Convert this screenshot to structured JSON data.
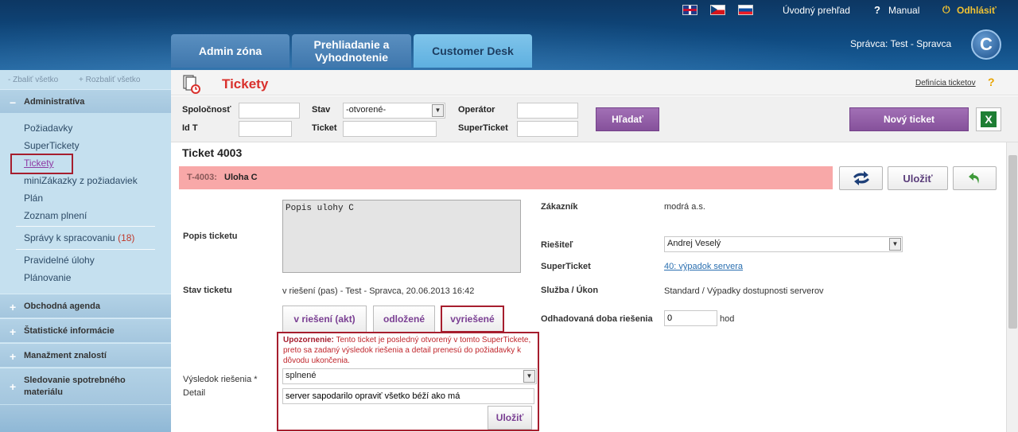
{
  "header": {
    "flags": [
      "uk-flag-icon",
      "cz-flag-icon",
      "sk-flag-icon"
    ],
    "overview_link": "Úvodný prehľad",
    "manual_link": "Manual",
    "logout_link": "Odhlásiť",
    "tabs": [
      "Admin zóna",
      "Prehliadanie a Vyhodnotenie",
      "Customer Desk"
    ],
    "active_tab": "Customer Desk",
    "manager_text": "Správca: Test - Spravca",
    "logo_letter": "C"
  },
  "sidebar": {
    "collapse_all": "- Zbaliť všetko",
    "expand_all": "+ Rozbaliť všetko",
    "sections": [
      {
        "label": "Administratíva",
        "sign": "−"
      },
      {
        "label": "Obchodná agenda",
        "sign": "+"
      },
      {
        "label": "Štatistické informácie",
        "sign": "+"
      },
      {
        "label": "Manažment znalostí",
        "sign": "+"
      },
      {
        "label": "Sledovanie spotrebného materiálu",
        "sign": "+"
      }
    ],
    "items": [
      "Požiadavky",
      "SuperTickety",
      "Tickety",
      "miniZákazky z požiadaviek",
      "Plán",
      "Zoznam plnení",
      "Správy k spracovaniu",
      "Pravidelné úlohy",
      "Plánovanie"
    ],
    "reports_count": "(18)",
    "active_item": "Tickety"
  },
  "page": {
    "title": "Tickety",
    "definition_link": "Definícia ticketov",
    "help_icon": "?"
  },
  "filters": {
    "company_label": "Spoločnosť",
    "company_value": "",
    "status_label": "Stav",
    "status_value": "-otvorené-",
    "operator_label": "Operátor",
    "operator_value": "",
    "id_label": "Id T",
    "id_value": "",
    "ticket_label": "Ticket",
    "ticket_value": "",
    "superticket_label": "SuperTicket",
    "superticket_value": "",
    "search_button": "Hľadať",
    "new_ticket_button": "Nový ticket"
  },
  "ticket": {
    "heading": "Ticket 4003",
    "code": "T-4003:",
    "name": "Uloha C",
    "save_button": "Uložiť",
    "description_label": "Popis ticketu",
    "description_value": "Popis ulohy C",
    "status_label": "Stav ticketu",
    "status_value": "v riešení (pas) - Test - Spravca, 20.06.2013 16:42",
    "state_buttons": [
      "v riešení (akt)",
      "odložené",
      "vyriešené"
    ],
    "customer_label": "Zákazník",
    "customer_value": "modrá a.s.",
    "solver_label": "Riešiteľ",
    "solver_value": "Andrej Veselý",
    "superticket_label": "SuperTicket",
    "superticket_link": "40: výpadok servera",
    "service_label": "Služba / Úkon",
    "service_value": "Standard / Výpadky dostupnosti serverov",
    "duration_label": "Odhadovaná doba riešenia",
    "duration_value": "0",
    "duration_unit": "hod",
    "warning_title": "Upozornenie:",
    "warning_text": "Tento ticket je posledný otvorený v tomto SuperTickete, preto sa zadaný výsledok riešenia a detail prenesú do požiadavky k dôvodu ukončenia.",
    "result_label": "Výsledok riešenia *",
    "result_value": "splnené",
    "detail_label": "Detail",
    "detail_value": "server sapodarilo opraviť všetko béží ako má",
    "detail_save_button": "Uložiť"
  }
}
